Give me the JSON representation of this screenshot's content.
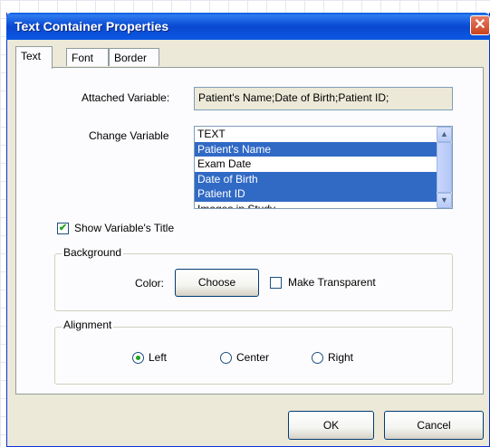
{
  "dialog": {
    "title": "Text Container Properties",
    "close_glyph": "✕"
  },
  "tabs": [
    {
      "label": "Text",
      "active": true
    },
    {
      "label": "Font",
      "active": false
    },
    {
      "label": "Border",
      "active": false
    }
  ],
  "attached_variable": {
    "label": "Attached Variable:",
    "value": "Patient's Name;Date of Birth;Patient ID;"
  },
  "change_variable": {
    "label": "Change Variable",
    "items": [
      {
        "text": "TEXT",
        "selected": false
      },
      {
        "text": "Patient's Name",
        "selected": true
      },
      {
        "text": "Exam Date",
        "selected": false
      },
      {
        "text": "Date of Birth",
        "selected": true
      },
      {
        "text": "Patient ID",
        "selected": true
      },
      {
        "text": "Images in Study",
        "selected": false
      }
    ]
  },
  "show_title": {
    "label": "Show Variable's Title",
    "checked": true
  },
  "background": {
    "group_label": "Background",
    "color_label": "Color:",
    "choose_label": "Choose",
    "transparent_label": "Make Transparent",
    "transparent_checked": false
  },
  "alignment": {
    "group_label": "Alignment",
    "options": [
      {
        "label": "Left",
        "selected": true
      },
      {
        "label": "Center",
        "selected": false
      },
      {
        "label": "Right",
        "selected": false
      }
    ]
  },
  "buttons": {
    "ok": "OK",
    "cancel": "Cancel"
  },
  "icons": {
    "scroll_up": "▲",
    "scroll_down": "▼",
    "check": "✔"
  },
  "colors": {
    "titlebar": "#0a49cf",
    "selection": "#316ac5",
    "dialog_bg": "#ece9d8",
    "panel_bg": "#fcfcfe"
  }
}
